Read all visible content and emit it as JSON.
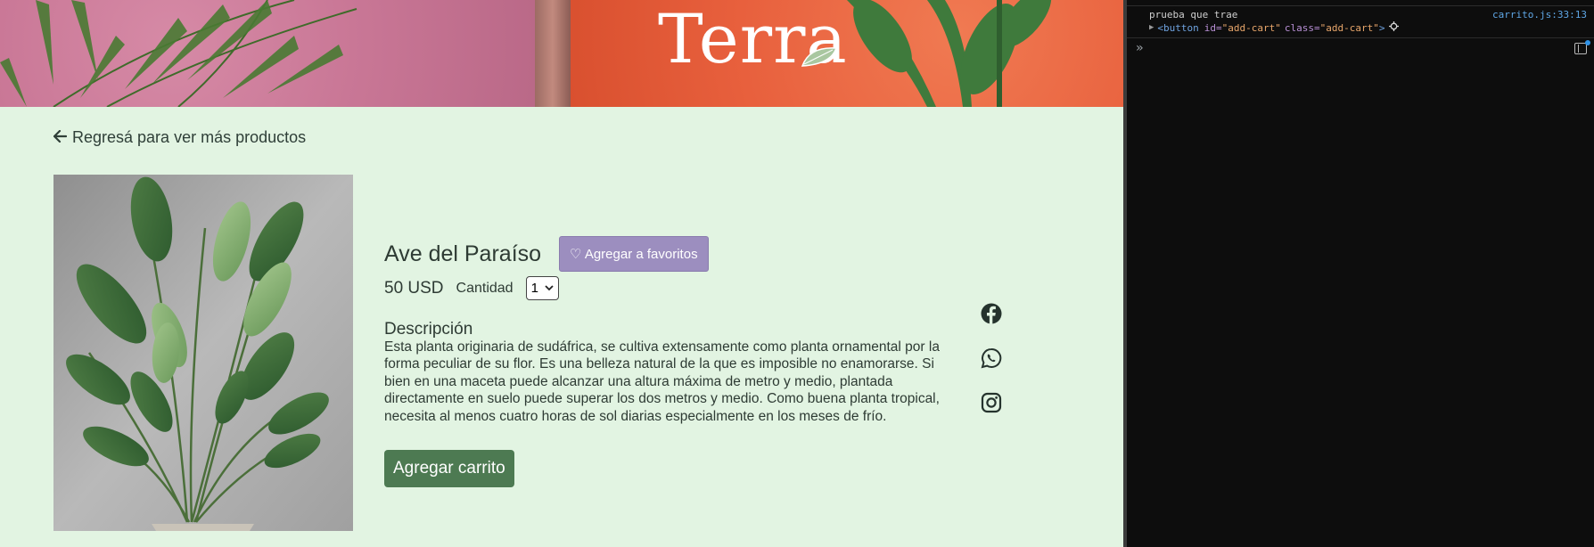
{
  "brand": {
    "logo_text": "Terra"
  },
  "nav": {
    "back_arrow": "🡐",
    "back_label": "Regresá para ver más productos"
  },
  "product": {
    "image_alt": "Ave del Paraíso",
    "title": "Ave del Paraíso",
    "favorites_label": "♡ Agregar a favoritos",
    "price": "50 USD",
    "quantity_label": "Cantidad",
    "quantity_value": "1",
    "quantity_chevron": "⌄",
    "description_title": "Descripción",
    "description_text": "Esta planta originaria de sudáfrica, se cultiva extensamente como planta ornamental por la forma peculiar de su flor. Es una belleza natural de la que es imposible no enamorarse. Si bien en una maceta puede alcanzar una altura máxima de metro y medio, plantada directamente en suelo puede superar los dos metros y medio. Como buena planta tropical, necesita al menos cuatro horas de sol diarias especialmente en los meses de frío.",
    "add_to_cart_label": "Agregar carrito"
  },
  "social": [
    {
      "icon": "facebook-icon"
    },
    {
      "icon": "whatsapp-icon"
    },
    {
      "icon": "instagram-icon"
    }
  ],
  "devtools": {
    "log_message": "prueba que trae",
    "log_source": "carrito.js:33:13",
    "element_tag_open": "<button",
    "element_id_attr": "id=",
    "element_id_val": "\"add-cart\"",
    "element_class_attr": "class=",
    "element_class_val": "\"add-cart\"",
    "element_tag_close": ">",
    "prompt_symbol": "»"
  },
  "colors": {
    "page_bg": "#e2f4e2",
    "text": "#2e3b34",
    "favorites_button": "#9c8ebf",
    "cart_button": "#4d7a52",
    "hero_pink": "#c97796",
    "hero_orange": "#e8603d",
    "devtools_bg": "#0d0d0d",
    "devtools_link": "#5fa7e6"
  }
}
